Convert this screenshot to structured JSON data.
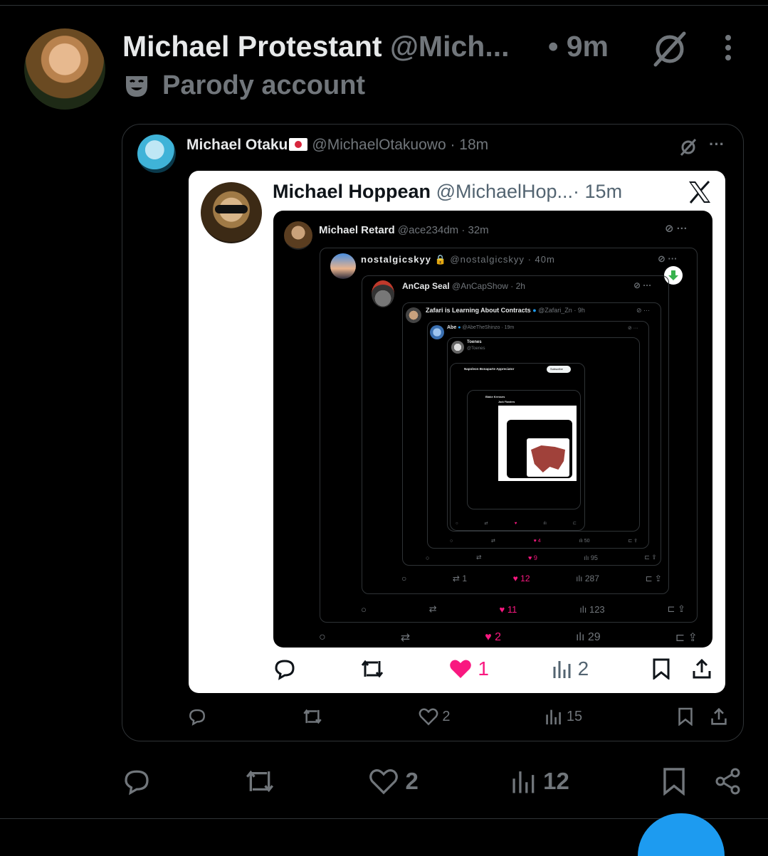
{
  "header": {
    "name": "Michael Protestant",
    "handle": "@Mich...",
    "time": "• 9m",
    "badge": "Parody account"
  },
  "quote1": {
    "name": "Michael Otaku",
    "handle": "@MichaelOtakuowo",
    "time": "· 18m",
    "stats": {
      "reply": "",
      "repost": "",
      "likes": "2",
      "views": "15"
    }
  },
  "hoppean": {
    "name": "Michael Hoppean",
    "handle": "@MichaelHop...",
    "time": "· 15m",
    "stats": {
      "likes": "1",
      "views": "2"
    }
  },
  "retard": {
    "name": "Michael Retard",
    "handle": "@ace234dm",
    "time": "· 32m",
    "stats": {
      "likes": "2",
      "views": "29"
    }
  },
  "nostalgic": {
    "name": "nostalgicskyy",
    "handle": "@nostalgicskyy",
    "time": "· 40m",
    "stats": {
      "likes": "11",
      "views": "123"
    }
  },
  "ancap": {
    "name": "AnCap Seal",
    "handle": "@AnCapShow",
    "time": "· 2h",
    "stats": {
      "repost": "1",
      "likes": "12",
      "views": "287"
    }
  },
  "zafari": {
    "name": "Zafari is Learning About Contracts",
    "handle": "@Zafari_Zn",
    "time": "· 9h",
    "stats": {
      "likes": "9",
      "views": "95"
    }
  },
  "abe": {
    "name": "Abe",
    "handle": "@AbeTheShinzo",
    "time": "· 19m",
    "stats": {
      "likes": "4",
      "views": "50"
    }
  },
  "toenes": {
    "name": "Toenes",
    "handle": "@Toenes"
  },
  "deep": {
    "napoleon": "Napoleon Bonaparte Appreciator",
    "subscribe": "Subscribe",
    "blake": "Blake Kresses",
    "jack": "Jack Flandres"
  },
  "main_actions": {
    "likes": "2",
    "views": "12"
  },
  "icons": [
    "grok-icon",
    "more-icon",
    "parody-mask-icon",
    "x-logo-icon",
    "reply-icon",
    "repost-icon",
    "heart-icon",
    "views-icon",
    "bookmark-icon",
    "share-icon"
  ],
  "colors": {
    "accent": "#1d9bf0",
    "like": "#f91880",
    "muted": "#71767b"
  }
}
